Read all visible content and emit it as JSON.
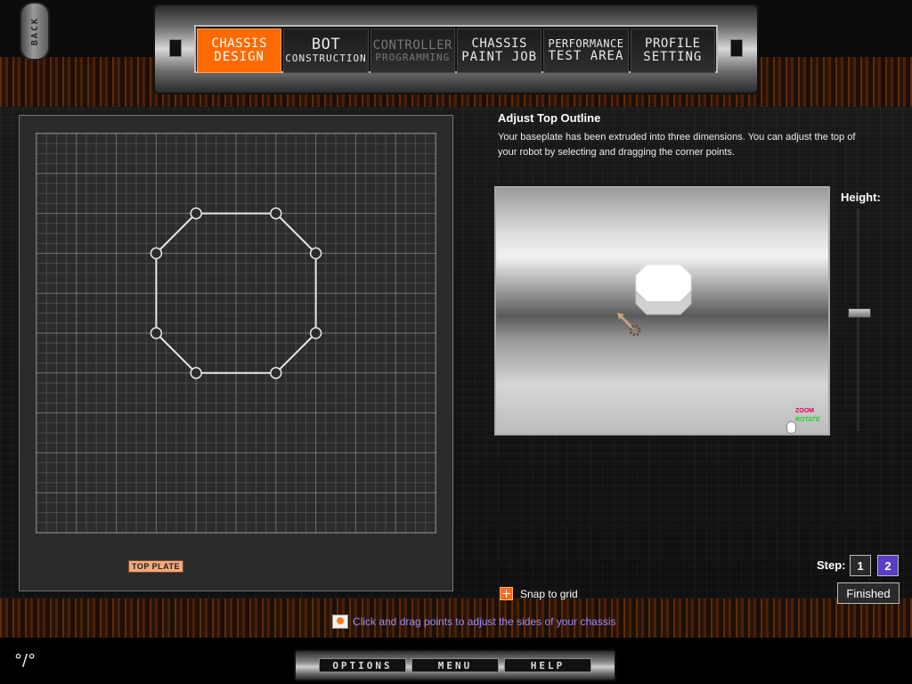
{
  "back": {
    "label": "BACK"
  },
  "nav": {
    "tabs": [
      {
        "line1": "CHASSIS",
        "line2": "DESIGN",
        "state": "active"
      },
      {
        "line1": "BOT",
        "line2": "CONSTRUCTION",
        "state": "normal"
      },
      {
        "line1": "CONTROLLER",
        "line2": "PROGRAMMING",
        "state": "disabled"
      },
      {
        "line1": "CHASSIS",
        "line2": "PAINT JOB",
        "state": "normal"
      },
      {
        "line1": "PERFORMANCE",
        "line2": "TEST AREA",
        "state": "normal"
      },
      {
        "line1": "PROFILE",
        "line2": "SETTING",
        "state": "normal"
      }
    ]
  },
  "editor": {
    "plate_label": "TOP PLATE",
    "grid_lines_per_side": 40,
    "outline_points": [
      [
        16,
        8
      ],
      [
        24,
        8
      ],
      [
        28,
        12
      ],
      [
        28,
        20
      ],
      [
        24,
        24
      ],
      [
        16,
        24
      ],
      [
        12,
        20
      ],
      [
        12,
        12
      ]
    ]
  },
  "instructions": {
    "title": "Adjust Top Outline",
    "text": "Your baseplate has been extruded into three dimensions. You can adjust the top of your robot by selecting and dragging the corner points."
  },
  "preview": {
    "zoom_label": "ZOOM",
    "rotate_label": "ROTATE"
  },
  "height": {
    "label": "Height:"
  },
  "steps": {
    "label": "Step:",
    "step1": "1",
    "step2": "2",
    "current": 2
  },
  "finished": {
    "label": "Finished"
  },
  "snap": {
    "label": "Snap to grid"
  },
  "hint": {
    "text": "Click and drag points to adjust the sides of your chassis"
  },
  "bottom_menu": {
    "options": "OPTIONS",
    "menu": "MENU",
    "help": "HELP"
  },
  "colors": {
    "accent": "#ff6a00",
    "step_active": "#5a3fc4",
    "hint": "#9a8cff"
  }
}
